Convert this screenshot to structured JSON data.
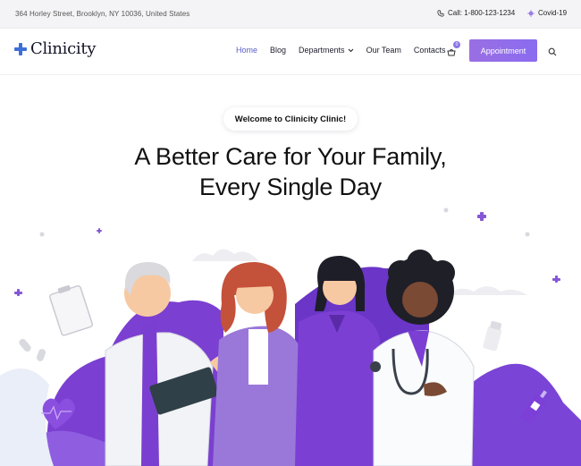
{
  "topbar": {
    "address": "364 Horley Street, Brooklyn, NY 10036, United States",
    "call": "Call: 1-800-123-1234",
    "covid": "Covid-19"
  },
  "header": {
    "logo": "Clinicity",
    "nav": [
      {
        "label": "Home",
        "active": true
      },
      {
        "label": "Blog"
      },
      {
        "label": "Departments",
        "dropdown": true
      },
      {
        "label": "Our Team"
      },
      {
        "label": "Contacts"
      }
    ],
    "cart_count": "0",
    "appointment": "Appointment"
  },
  "hero": {
    "welcome": "Welcome to Clinicity Clinic!",
    "headline_line1": "A Better Care for Your Family,",
    "headline_line2": "Every Single Day"
  },
  "colors": {
    "accent": "#8b6cf0",
    "nav_active": "#5a5ec9",
    "logo_cross": "#3e6fd8",
    "topbar_bg": "#f4f4f6"
  }
}
